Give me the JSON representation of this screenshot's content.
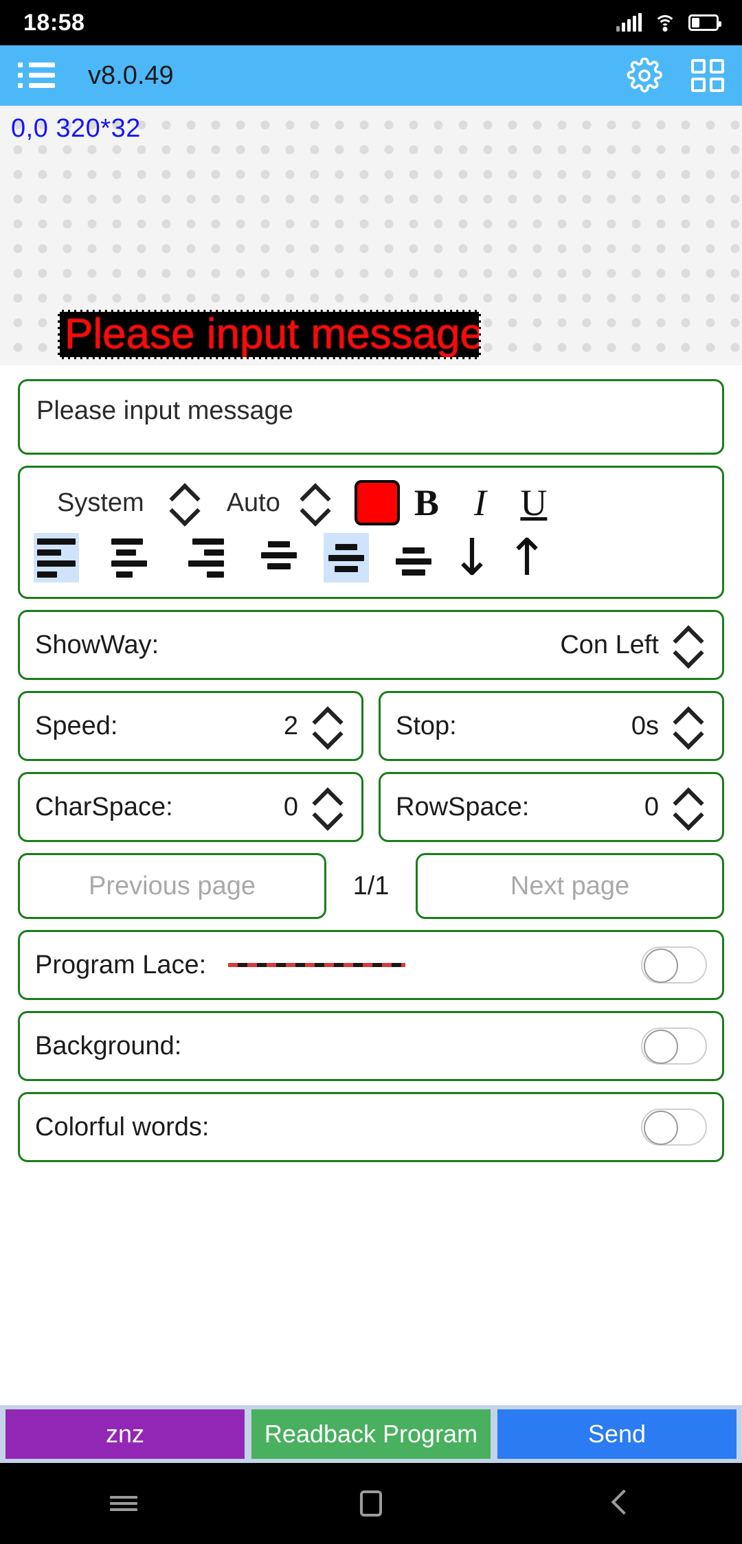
{
  "status_bar": {
    "time": "18:58",
    "icons": [
      "signal-icon",
      "wifi-icon",
      "battery-icon"
    ]
  },
  "app_bar": {
    "menu_icon": "list-menu-icon",
    "title": "v8.0.49",
    "settings_icon": "gear-icon",
    "grid_icon": "grid-apps-icon"
  },
  "preview": {
    "coordinates": "0,0 320*32",
    "led_text": "Please input message",
    "led_text_color": "#ff0000",
    "led_background": "#000000"
  },
  "message_input": {
    "value": "Please input message",
    "placeholder": "Please input message"
  },
  "toolbar": {
    "font_name": "System",
    "font_size": "Auto",
    "color_swatch": "#ff0000",
    "bold": "B",
    "italic": "I",
    "underline": "U",
    "align_icons": [
      {
        "name": "align-left-icon",
        "selected": true
      },
      {
        "name": "align-center-icon",
        "selected": false
      },
      {
        "name": "align-right-icon",
        "selected": false
      },
      {
        "name": "align-top-icon",
        "selected": false
      },
      {
        "name": "align-middle-icon",
        "selected": true
      },
      {
        "name": "align-bottom-icon",
        "selected": false
      }
    ],
    "arrow_down": "↓",
    "arrow_up": "↑"
  },
  "settings": {
    "showway": {
      "label": "ShowWay:",
      "value": "Con Left"
    },
    "speed": {
      "label": "Speed:",
      "value": "2"
    },
    "stop": {
      "label": "Stop:",
      "value": "0s"
    },
    "charspace": {
      "label": "CharSpace:",
      "value": "0"
    },
    "rowspace": {
      "label": "RowSpace:",
      "value": "0"
    }
  },
  "pager": {
    "previous": "Previous page",
    "page_indicator": "1/1",
    "next": "Next page"
  },
  "toggles": [
    {
      "label": "Program Lace:",
      "on": false,
      "has_line_preview": true
    },
    {
      "label": "Background:",
      "on": false,
      "has_line_preview": false
    },
    {
      "label": "Colorful words:",
      "on": false,
      "has_line_preview": false
    }
  ],
  "actions": {
    "znz": "znz",
    "readback": "Readback Program",
    "send": "Send",
    "colors": {
      "znz": "#9327b5",
      "readback": "#49b05f",
      "send": "#2b7bf2"
    }
  },
  "nav_bar": {
    "recents": "recents-icon",
    "home": "home-icon",
    "back": "back-icon"
  }
}
